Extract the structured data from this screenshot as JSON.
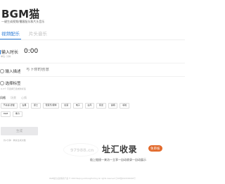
{
  "brand": {
    "title": "BGM猫",
    "subtitle": "一键生成视频/播客配乐和片头音乐"
  },
  "tabs": [
    "视频配乐",
    "片头音乐"
  ],
  "duration": {
    "label": "输入时长",
    "hint": "单位: 分钟",
    "value": "0:00"
  },
  "description": {
    "label": "输入描述",
    "placeholder": "写下你的创意"
  },
  "tags": {
    "label": "选择标签",
    "hint": "0-3个  可选择已选或新标签",
    "style_tabs": [
      "风格",
      "场景",
      "心情"
    ],
    "items": [
      "节奏感·舒缓",
      "古典",
      "爵士",
      "轻音乐/钢琴",
      "摇滚",
      "电子",
      "古风",
      "民谣",
      "说唱",
      "嘻哈",
      "R&B",
      "重力"
    ]
  },
  "generate": {
    "button": "生成",
    "hint": "约1分钟 · 剩余生成次数"
  },
  "overlay": {
    "watermark": "97988.cn",
    "title": "址汇收录",
    "badge": "免审核",
    "slogan": "极上链接—来访—立享—自动收录—自动展示"
  },
  "footer": "BGM猫为灵感探索产品 © 2022 Beijing AiChangHaiYing All rights reserved 京ICP备2022000000号"
}
